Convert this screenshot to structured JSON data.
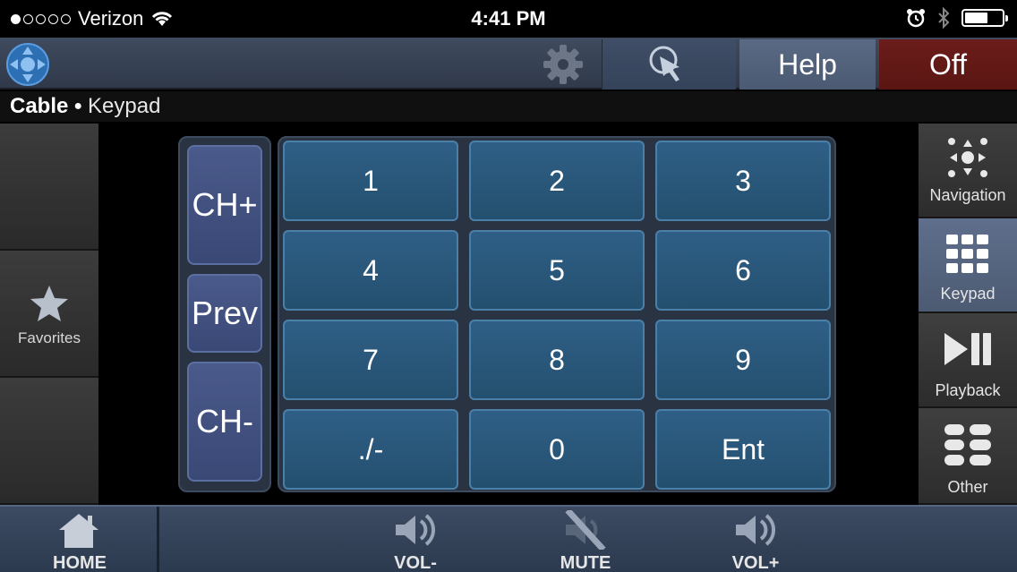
{
  "status_bar": {
    "carrier": "Verizon",
    "signal_bars_filled": 1,
    "signal_bars_total": 5,
    "time": "4:41 PM",
    "battery_level": 0.62
  },
  "top_bar": {
    "help_label": "Help",
    "off_label": "Off"
  },
  "breadcrumb": {
    "device": "Cable",
    "separator": "●",
    "page": "Keypad"
  },
  "left_panel": {
    "favorites_label": "Favorites"
  },
  "channel": {
    "ch_up": "CH+",
    "prev": "Prev",
    "ch_down": "CH-"
  },
  "keypad": {
    "keys": [
      "1",
      "2",
      "3",
      "4",
      "5",
      "6",
      "7",
      "8",
      "9",
      "./-",
      "0",
      "Ent"
    ]
  },
  "right_panel": {
    "items": [
      {
        "label": "Navigation",
        "icon": "navigation-icon",
        "active": false
      },
      {
        "label": "Keypad",
        "icon": "keypad-icon",
        "active": true
      },
      {
        "label": "Playback",
        "icon": "playback-icon",
        "active": false
      },
      {
        "label": "Other",
        "icon": "other-icon",
        "active": false
      }
    ]
  },
  "bottom_bar": {
    "home": "HOME",
    "vol_down": "VOL-",
    "mute": "MUTE",
    "vol_up": "VOL+"
  },
  "colors": {
    "accent_blue": "#2f5f86",
    "off_red": "#6b1d1a",
    "active_tab": "#5f6f8c"
  }
}
